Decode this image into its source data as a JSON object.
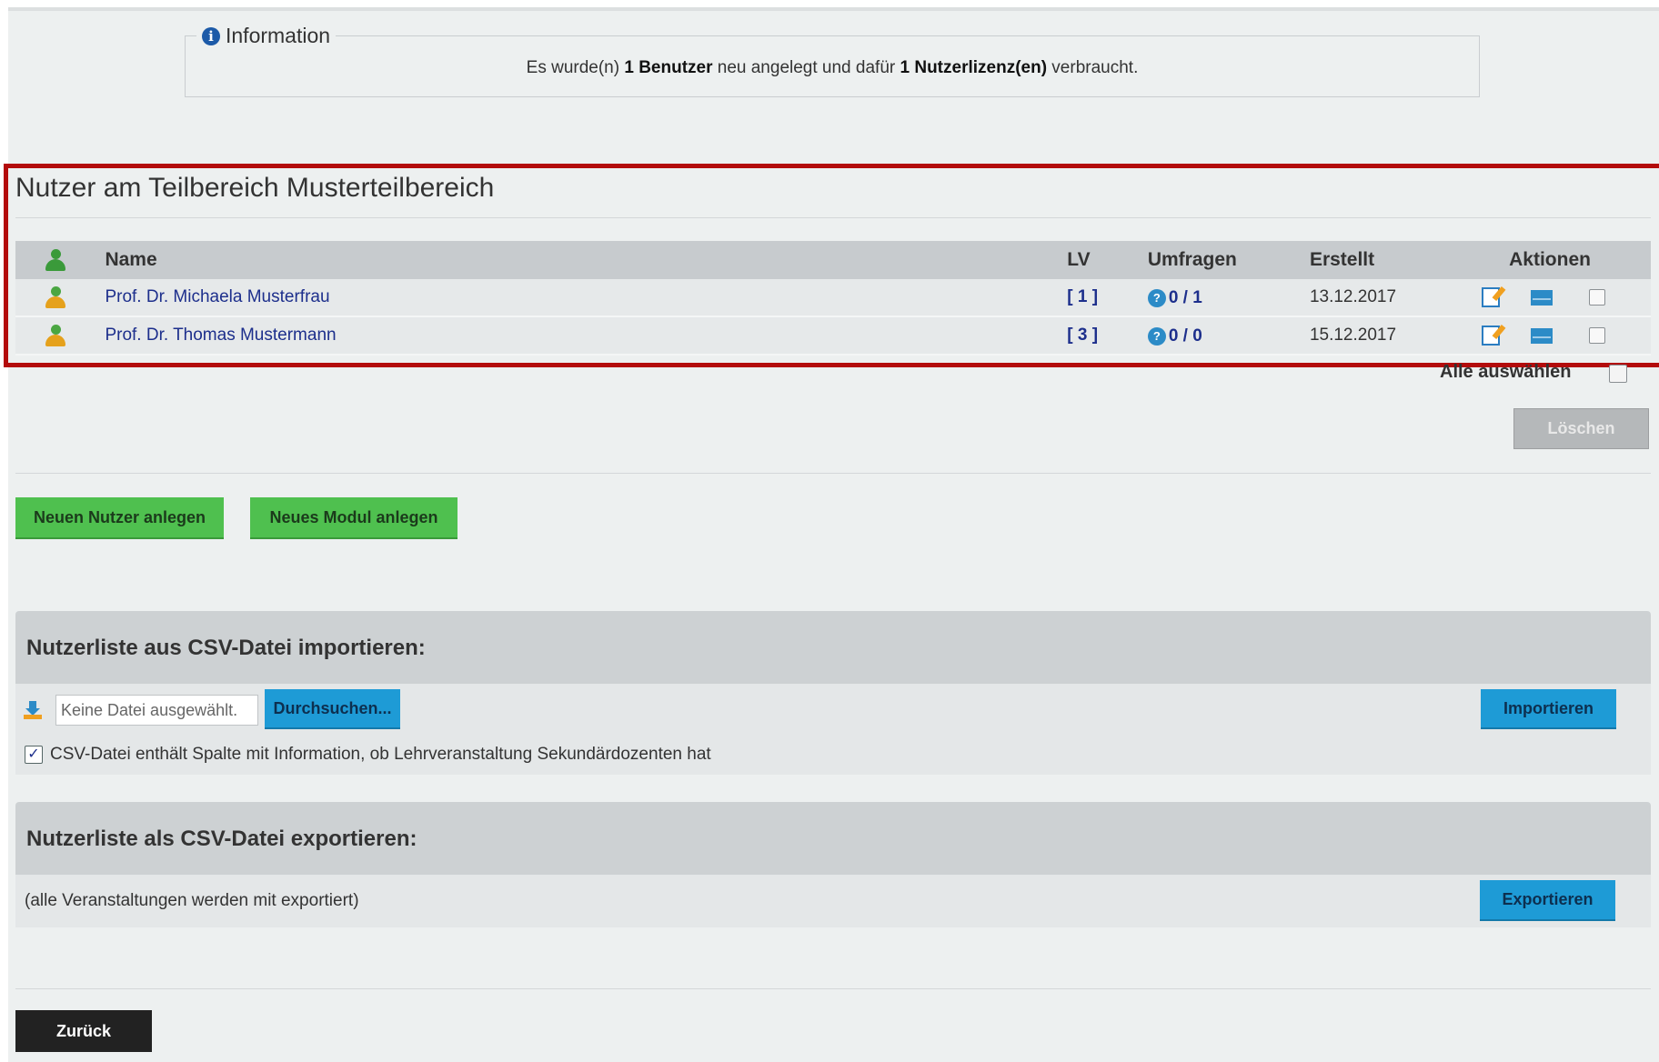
{
  "info": {
    "legend": "Information",
    "msg_pre": "Es wurde(n) ",
    "msg_b1": "1 Benutzer",
    "msg_mid": " neu angelegt und dafür ",
    "msg_b2": "1 Nutzerlizenz(en)",
    "msg_post": " verbraucht."
  },
  "section_title": "Nutzer am Teilbereich Musterteilbereich",
  "table": {
    "headers": {
      "name": "Name",
      "lv": "LV",
      "umfragen": "Umfragen",
      "erstellt": "Erstellt",
      "aktionen": "Aktionen"
    },
    "rows": [
      {
        "name": "Prof. Dr. Michaela Musterfrau",
        "lv": "[ 1 ]",
        "umfragen": "0 / 1",
        "erstellt": "13.12.2017"
      },
      {
        "name": "Prof. Dr. Thomas Mustermann",
        "lv": "[ 3 ]",
        "umfragen": "0 / 0",
        "erstellt": "15.12.2017"
      }
    ]
  },
  "select_all_label": "Alle auswählen",
  "delete_label": "Löschen",
  "new_user_label": "Neuen Nutzer anlegen",
  "new_module_label": "Neues Modul anlegen",
  "import": {
    "title": "Nutzerliste aus CSV-Datei importieren:",
    "file_placeholder": "Keine Datei ausgewählt.",
    "browse_label": "Durchsuchen...",
    "import_label": "Importieren",
    "checkbox_checked": true,
    "checkbox_label": "CSV-Datei enthält Spalte mit Information, ob Lehrveranstaltung Sekundärdozenten hat"
  },
  "export": {
    "title": "Nutzerliste als CSV-Datei exportieren:",
    "note": "(alle Veranstaltungen werden mit exportiert)",
    "export_label": "Exportieren"
  },
  "back_label": "Zurück",
  "colors": {
    "highlight_frame": "#b30c0c",
    "green_button": "#4fc04f",
    "blue_button": "#1e9bd6",
    "link": "#1d2f8c"
  },
  "icons": [
    "info-icon",
    "person-icon",
    "survey-icon",
    "edit-icon",
    "mail-icon",
    "download-icon"
  ]
}
